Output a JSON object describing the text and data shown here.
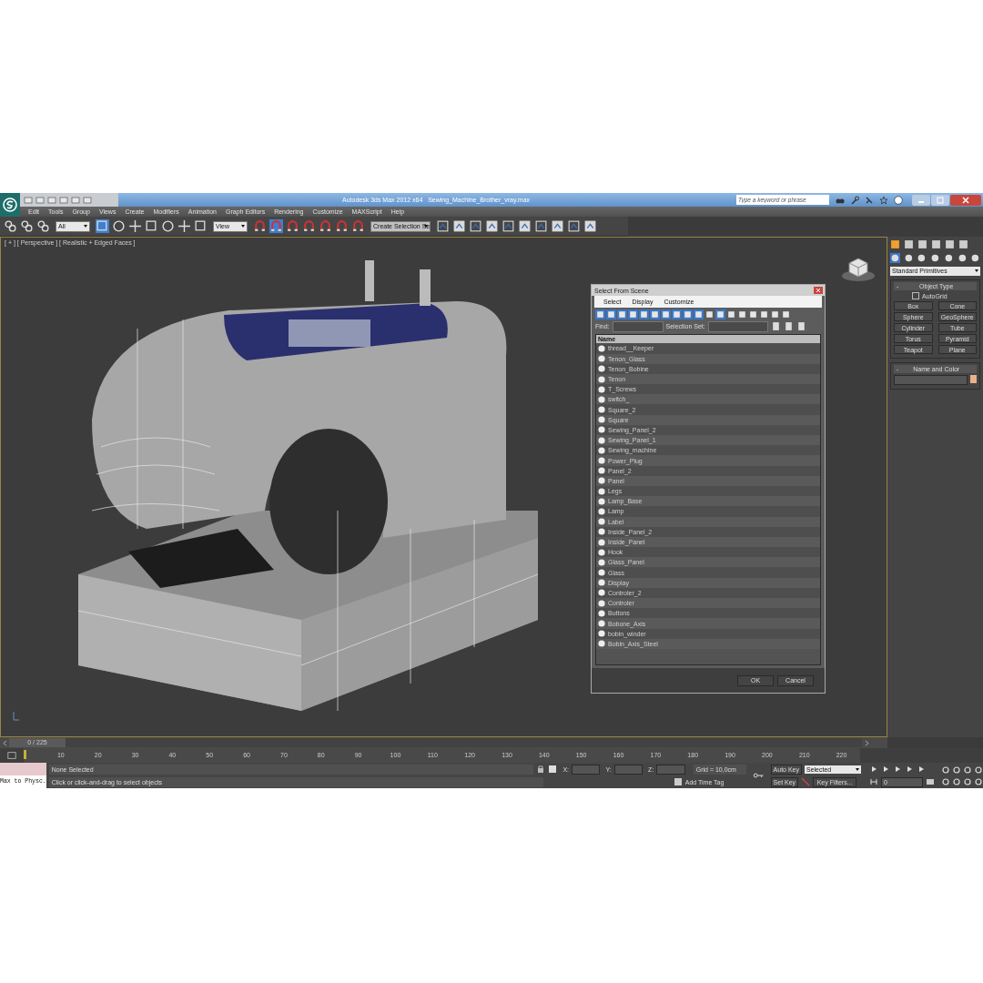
{
  "title_bar": {
    "app": "Autodesk 3ds Max  2012 x64",
    "file": "Sewing_Machine_Brother_vray.max",
    "search": {
      "placeholder": "Type a keyword or phrase"
    }
  },
  "menu": [
    "Edit",
    "Tools",
    "Group",
    "Views",
    "Create",
    "Modifiers",
    "Animation",
    "Graph Editors",
    "Rendering",
    "Customize",
    "MAXScript",
    "Help"
  ],
  "toolbar": {
    "selection_filter": "All",
    "reference_coord": "View",
    "named_selection": "Create Selection Se"
  },
  "viewport": {
    "label": "[ + ] [ Perspective ] [ Realistic + Edged Faces ]"
  },
  "dialog": {
    "title": "Select From Scene",
    "menu": [
      "Select",
      "Display",
      "Customize"
    ],
    "find_label": "Find:",
    "selection_set_label": "Selection Set:",
    "column": "Name",
    "items": [
      "thread__Keeper",
      "Tenon_Glass",
      "Tenon_Bobine",
      "Tenon",
      "T_Screws",
      "switch_",
      "Square_2",
      "Square",
      "Sewing_Panel_2",
      "Sewing_Panel_1",
      "Sewing_machine",
      "Power_Plug",
      "Panel_2",
      "Panel",
      "Legs",
      "Lamp_Base",
      "Lamp",
      "Label",
      "Inside_Panel_2",
      "Inside_Panel",
      "Hook",
      "Glass_Panel",
      "Glass",
      "Display",
      "Controler_2",
      "Controler",
      "Buttons",
      "Bobone_Axis",
      "bobin_winder",
      "Bobin_Axis_Steel"
    ],
    "buttons": [
      "OK",
      "Cancel"
    ]
  },
  "command_panel": {
    "dropdown": "Standard Primitives",
    "object_type": {
      "toggle": "-",
      "title": "Object Type",
      "autogrid": {
        "label": "AutoGrid",
        "checked": false
      },
      "buttons": [
        "Box",
        "Cone",
        "Sphere",
        "GeoSphere",
        "Cylinder",
        "Tube",
        "Torus",
        "Pyramid",
        "Teapot",
        "Plane"
      ]
    },
    "name_and_color": {
      "toggle": "-",
      "title": "Name and Color",
      "color": "#e8b08c"
    }
  },
  "timeline": {
    "position": "0 / 225",
    "level": 0,
    "ticks": [
      "10",
      "20",
      "30",
      "40",
      "50",
      "60",
      "70",
      "80",
      "90",
      "100",
      "110",
      "120",
      "130",
      "140",
      "150",
      "160",
      "170",
      "180",
      "190",
      "200",
      "210",
      "220"
    ]
  },
  "status": {
    "listener": "Max to Physc.",
    "selection": "None Selected",
    "prompt": "Click or click-and-drag to select objects",
    "coords": [
      "X:",
      "Y:",
      "Z:"
    ],
    "grid": "Grid = 10,0cm",
    "add_time_tag": "Add Time Tag",
    "auto_key": "Auto Key",
    "key_mode": "Selected",
    "set_key": "Set Key",
    "key_filters": "Key Filters...",
    "frame": "0"
  }
}
